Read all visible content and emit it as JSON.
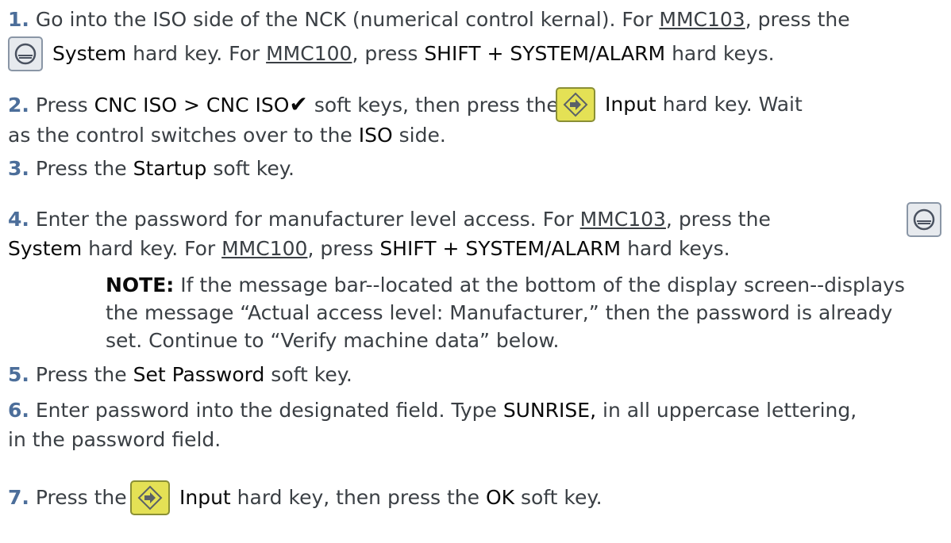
{
  "steps": [
    {
      "num": "1.",
      "l1": {
        "a": "Go into the ISO side of the NCK (numerical control kernal). For ",
        "b": "MMC103",
        "c": ", press the"
      },
      "l2": {
        "sys": "System",
        "a": " hard key. For ",
        "b": "MMC100",
        "c": ", press ",
        "d": "SHIFT + SYSTEM/ALARM",
        "e": " hard keys."
      }
    },
    {
      "num": "2.",
      "l1": {
        "a": "Press ",
        "b": "CNC ISO > CNC ISO",
        "check": "✔",
        "c": "  soft keys, then press the",
        "d": "Input",
        "e": " hard key. Wait"
      },
      "l2": {
        "a": "as the control switches over to the ",
        "b": "ISO",
        "c": " side."
      }
    },
    {
      "num": "3.",
      "a": "Press the ",
      "b": "Startup",
      "c": " soft key."
    },
    {
      "num": "4.",
      "l1": {
        "a": "Enter the password for manufacturer level access. For ",
        "b": "MMC103",
        "c": ", press the"
      },
      "l2": {
        "sys": "System",
        "a": " hard key. For ",
        "b": "MMC100",
        "c": ", press ",
        "d": "SHIFT + SYSTEM/ALARM",
        "e": " hard keys."
      }
    },
    {
      "note_label": "NOTE:",
      "note_lines": [
        " If the message bar--located at the bottom of the display screen--displays",
        "the message “Actual access level: Manufacturer,” then the password is already",
        "set. Continue to “Verify machine data” below."
      ]
    },
    {
      "num": "5.",
      "a": "Press the ",
      "b": "Set Password",
      "c": " soft key."
    },
    {
      "num": "6.",
      "l1": {
        "a": "Enter password into the designated field. Type ",
        "b": "SUNRISE,",
        "c": " in all uppercase lettering,"
      },
      "l2": {
        "a": "in the password field."
      }
    },
    {
      "num": "7.",
      "a": "Press the",
      "b": "Input",
      "c": " hard key, then press the ",
      "d": "OK",
      "e": " soft key."
    }
  ],
  "icons": {
    "system_key": "system-key-icon",
    "input_key": "input-key-icon"
  },
  "colors": {
    "step_number": "#4c6e9a",
    "emphasis": "#0a0a0a",
    "body_text": "#3a3f44",
    "input_key": "#e4e155",
    "system_key": "#e7eaee"
  }
}
